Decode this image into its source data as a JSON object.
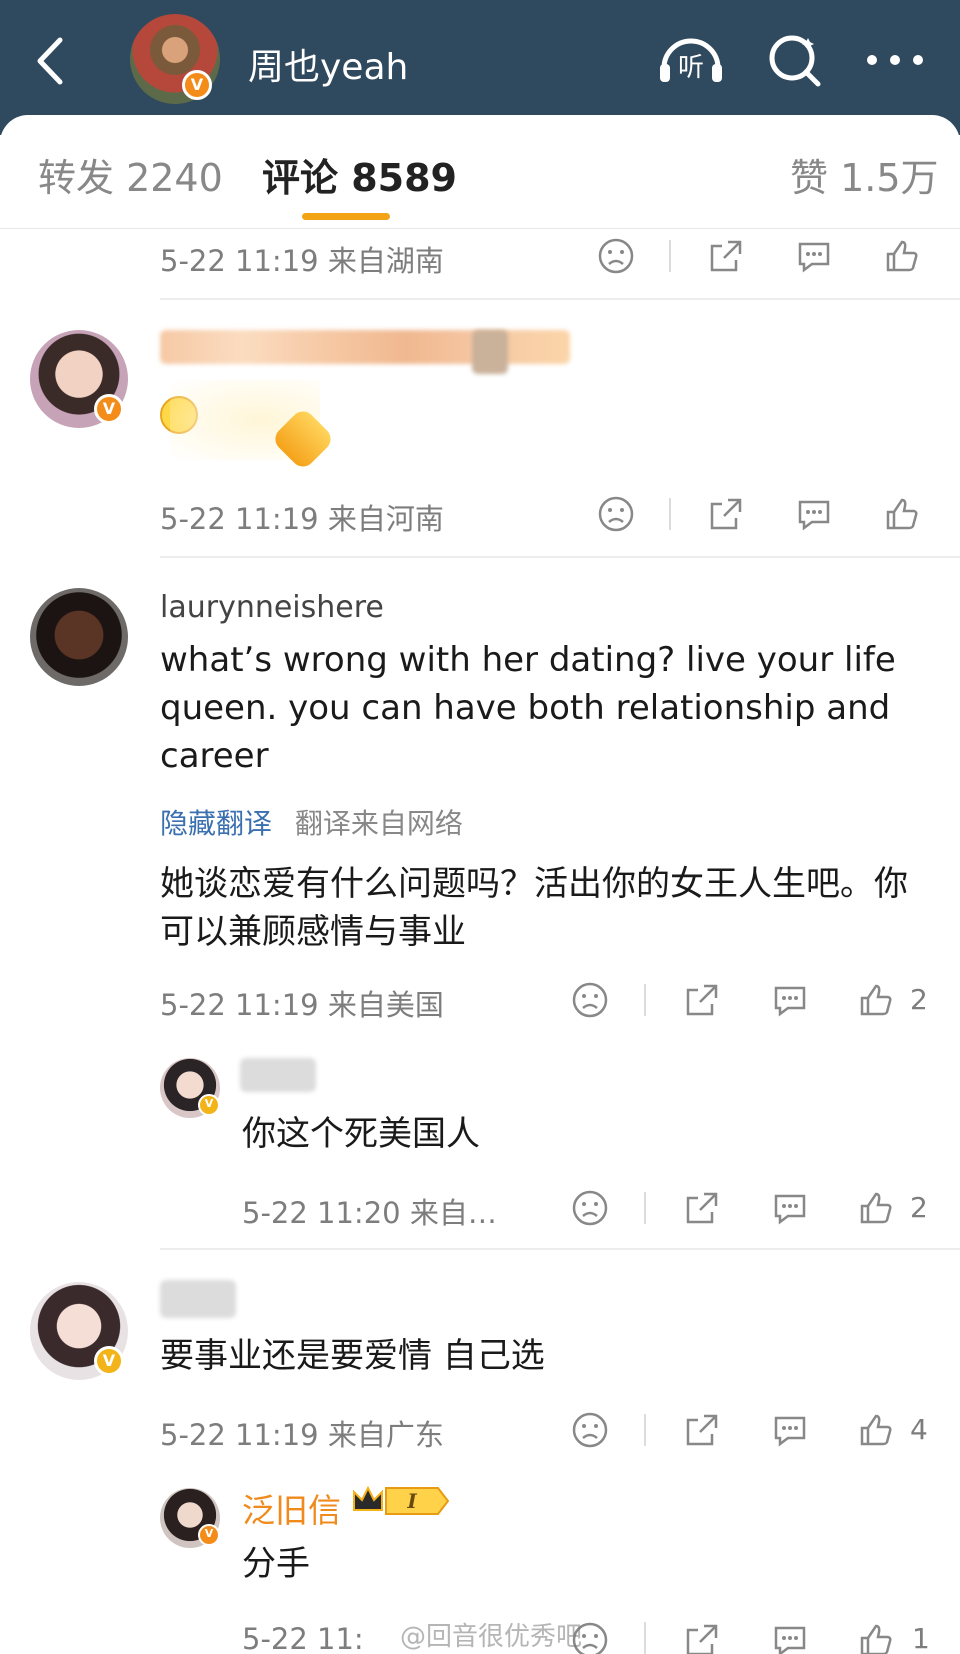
{
  "header": {
    "title": "周也yeah",
    "listen_label": "听",
    "colors": {
      "bar": "#2f4a5e",
      "accent": "#f3a316"
    },
    "icons": [
      "back-arrow-icon",
      "listen-headphone-icon",
      "search-icon",
      "more-dots-icon"
    ]
  },
  "tabs": [
    {
      "label": "转发 2240"
    },
    {
      "label": "评论 8589",
      "active": true
    },
    {
      "label": "赞 1.5万"
    }
  ],
  "comments": [
    {
      "meta": "5-22 11:19 来自湖南"
    },
    {
      "meta": "5-22 11:19 来自河南"
    },
    {
      "username": "laurynneishere",
      "text": "what’s wrong with her dating? live your life queen. you can have both relationship and career",
      "translate_toggle": "隐藏翻译",
      "translate_source": "翻译来自网络",
      "translation": "她谈恋爱有什么问题吗？活出你的女王人生吧。你可以兼顾感情与事业",
      "meta": "5-22 11:19 来自美国",
      "likes": "2",
      "reply": {
        "text": "你这个死美国人",
        "meta": "5-22 11:20 来自…",
        "likes": "2"
      }
    },
    {
      "text": "要事业还是要爱情 自己选",
      "meta": "5-22 11:19 来自广东",
      "likes": "4",
      "reply": {
        "username": "泛旧信",
        "badge": "I",
        "text": "分手",
        "meta": "5-22 11:",
        "likes": "1"
      }
    }
  ],
  "watermark": "@回音很优秀吧"
}
